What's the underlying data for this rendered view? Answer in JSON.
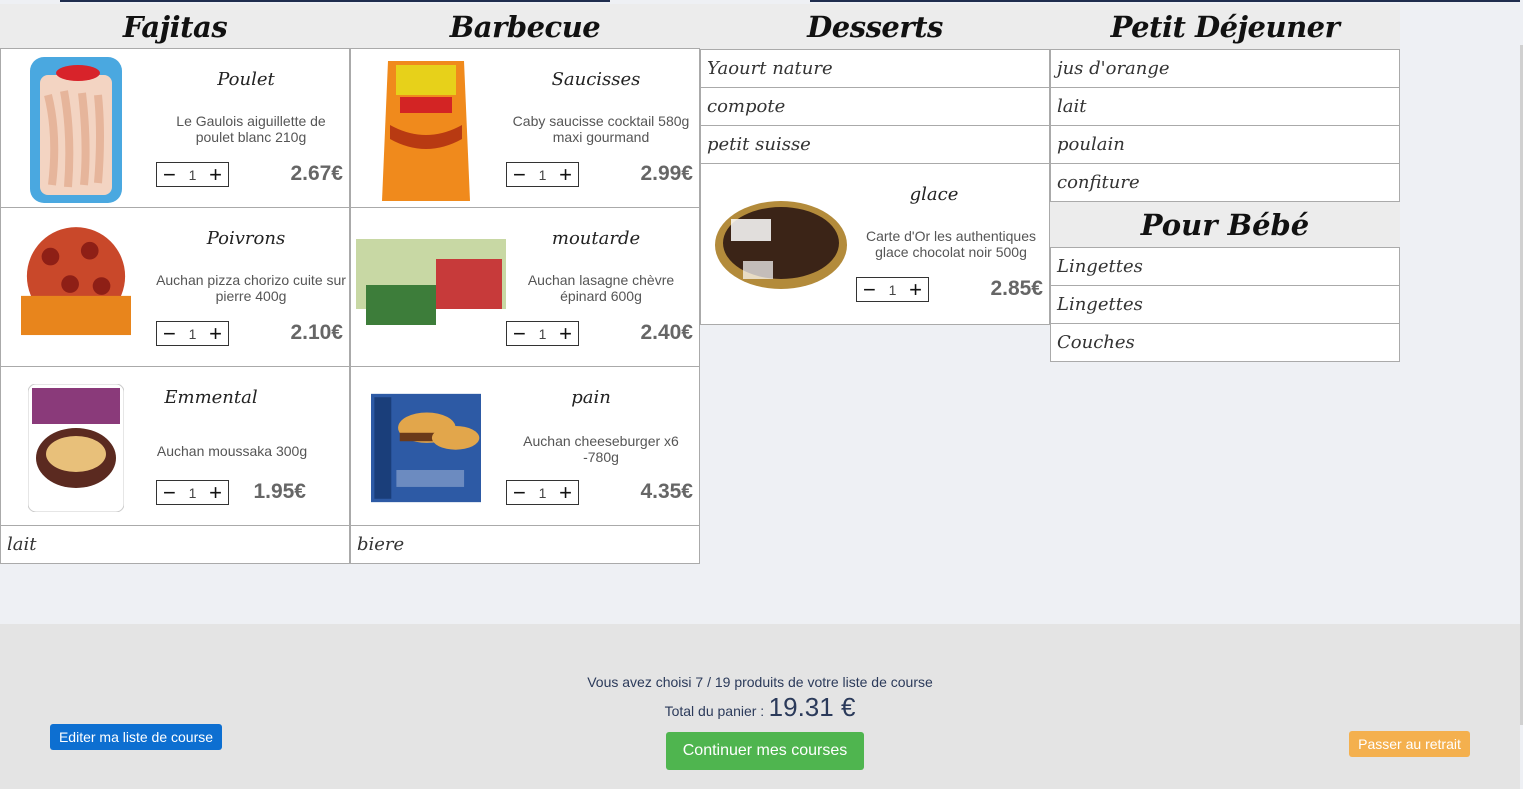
{
  "columns": {
    "fajitas": {
      "title": "Fajitas",
      "products": [
        {
          "name": "Poulet",
          "desc": "Le Gaulois aiguillette de poulet blanc 210g",
          "qty": "1",
          "price": "2.67€",
          "icon": "chicken-pack-image"
        },
        {
          "name": "Poivrons",
          "desc": "Auchan pizza chorizo cuite sur pierre 400g",
          "qty": "1",
          "price": "2.10€",
          "icon": "pizza-box-image"
        },
        {
          "name": "Emmental",
          "desc": "Auchan moussaka 300g",
          "qty": "1",
          "price": "1.95€",
          "icon": "moussaka-box-image"
        }
      ],
      "items": [
        "lait"
      ]
    },
    "barbecue": {
      "title": "Barbecue",
      "products": [
        {
          "name": "Saucisses",
          "desc": "Caby saucisse cocktail 580g maxi gourmand",
          "qty": "1",
          "price": "2.99€",
          "icon": "sausage-bag-image"
        },
        {
          "name": "moutarde",
          "desc": "Auchan lasagne chèvre épinard 600g",
          "qty": "1",
          "price": "2.40€",
          "icon": "lasagna-box-image"
        },
        {
          "name": "pain",
          "desc": "Auchan cheeseburger x6 -780g",
          "qty": "1",
          "price": "4.35€",
          "icon": "cheeseburger-box-image"
        }
      ],
      "items": [
        "biere"
      ]
    },
    "desserts": {
      "title": "Desserts",
      "items": [
        "Yaourt nature",
        "compote",
        "petit suisse"
      ],
      "products": [
        {
          "name": "glace",
          "desc": "Carte d'Or les authentiques glace chocolat noir 500g",
          "qty": "1",
          "price": "2.85€",
          "icon": "ice-cream-tub-image"
        }
      ]
    },
    "petit_dejeuner": {
      "title": "Petit Déjeuner",
      "items": [
        "jus d'orange",
        "lait",
        "poulain",
        "confiture"
      ]
    },
    "pour_bebe": {
      "title": "Pour Bébé",
      "items": [
        "Lingettes",
        "Lingettes",
        "Couches"
      ]
    }
  },
  "footer": {
    "summary": "Vous avez choisi 7 / 19 produits de votre liste de course",
    "total_label": "Total du panier :",
    "total_value": "19.31 €",
    "edit_button": "Editer ma liste de course",
    "continue_button": "Continuer mes courses",
    "checkout_button": "Passer au retrait"
  },
  "colors": {
    "blue_button": "#0d6fd1",
    "green_button": "#4fb54f",
    "orange_button": "#f4b04e",
    "header_bg": "#ececec"
  }
}
